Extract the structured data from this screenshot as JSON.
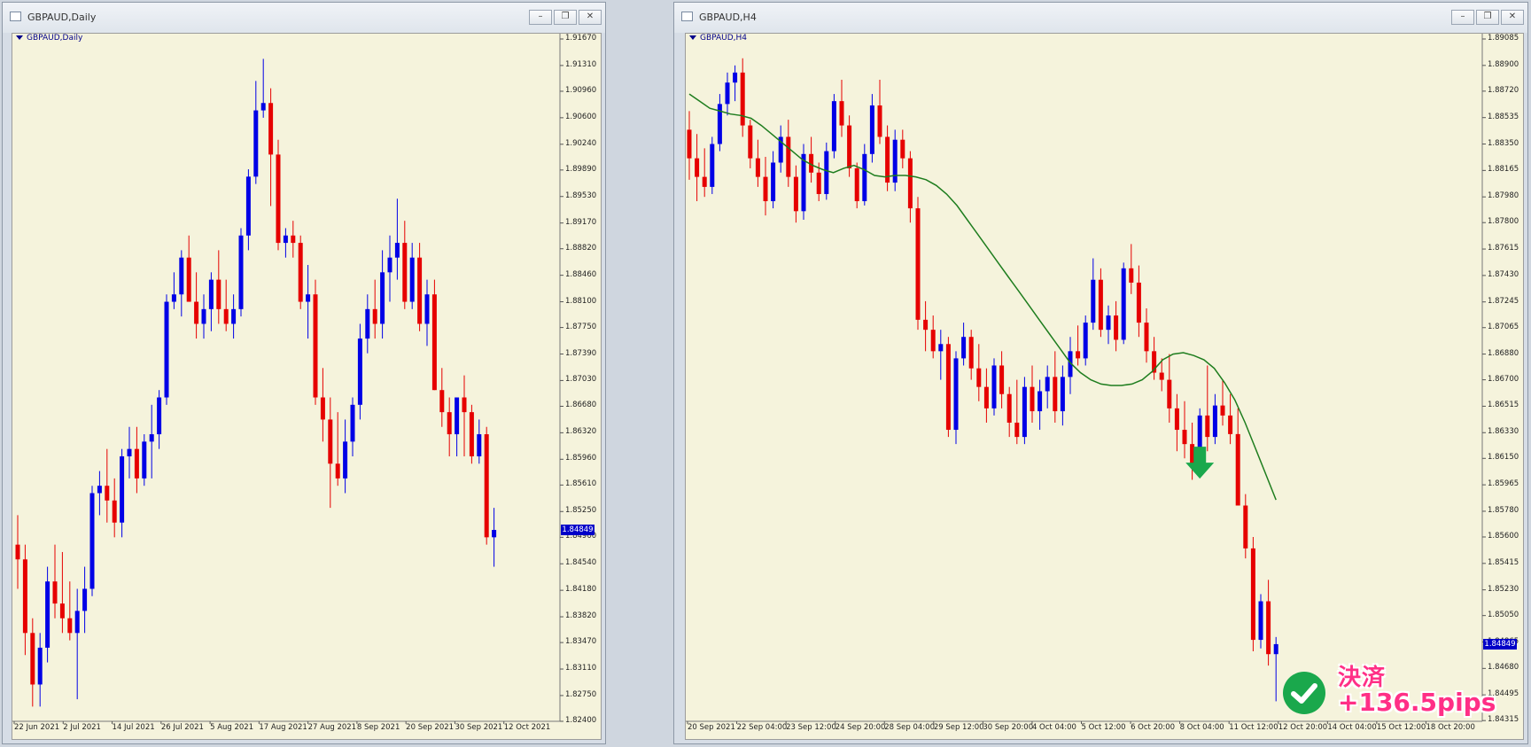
{
  "left_window": {
    "title": "GBPAUD,Daily",
    "chart_label": "GBPAUD,Daily",
    "current_price": "1.84849",
    "controls": [
      "minimize",
      "restore",
      "close"
    ]
  },
  "right_window": {
    "title": "GBPAUD,H4",
    "chart_label": "GBPAUD,H4",
    "current_price": "1.84849",
    "controls": [
      "minimize",
      "restore",
      "close"
    ]
  },
  "overlay": {
    "line1": "決済",
    "line2": "+136.5pips",
    "check_icon": "check-circle-icon",
    "arrow_icon": "down-arrow-icon"
  },
  "colors": {
    "bull": "#0000e6",
    "bear": "#e60000",
    "ma": "#1e7d1e",
    "chart_bg": "#f5f3dc",
    "arrow": "#1aa84c"
  },
  "chart_data": [
    {
      "type": "candlestick",
      "symbol": "GBPAUD",
      "timeframe": "Daily",
      "ylim": [
        1.824,
        1.9167
      ],
      "y_ticks": [
        "1.91670",
        "1.91310",
        "1.90960",
        "1.90600",
        "1.90240",
        "1.89890",
        "1.89530",
        "1.89170",
        "1.88820",
        "1.88460",
        "1.88100",
        "1.87750",
        "1.87390",
        "1.87030",
        "1.86680",
        "1.86320",
        "1.85960",
        "1.85610",
        "1.85250",
        "1.84900",
        "1.84540",
        "1.84180",
        "1.83820",
        "1.83470",
        "1.83110",
        "1.82750",
        "1.82400"
      ],
      "x_ticks": [
        "22 Jun 2021",
        "2 Jul 2021",
        "14 Jul 2021",
        "26 Jul 2021",
        "5 Aug 2021",
        "17 Aug 2021",
        "27 Aug 2021",
        "8 Sep 2021",
        "20 Sep 2021",
        "30 Sep 2021",
        "12 Oct 2021"
      ],
      "ohlc": [
        [
          1.848,
          1.852,
          1.842,
          1.846
        ],
        [
          1.846,
          1.848,
          1.833,
          1.836
        ],
        [
          1.836,
          1.838,
          1.826,
          1.829
        ],
        [
          1.829,
          1.836,
          1.826,
          1.834
        ],
        [
          1.834,
          1.845,
          1.832,
          1.843
        ],
        [
          1.843,
          1.848,
          1.838,
          1.84
        ],
        [
          1.84,
          1.847,
          1.836,
          1.838
        ],
        [
          1.838,
          1.843,
          1.835,
          1.836
        ],
        [
          1.836,
          1.842,
          1.827,
          1.839
        ],
        [
          1.839,
          1.845,
          1.836,
          1.842
        ],
        [
          1.842,
          1.856,
          1.841,
          1.855
        ],
        [
          1.855,
          1.858,
          1.852,
          1.856
        ],
        [
          1.856,
          1.861,
          1.851,
          1.854
        ],
        [
          1.854,
          1.857,
          1.849,
          1.851
        ],
        [
          1.851,
          1.861,
          1.849,
          1.86
        ],
        [
          1.86,
          1.864,
          1.857,
          1.861
        ],
        [
          1.861,
          1.864,
          1.855,
          1.857
        ],
        [
          1.857,
          1.863,
          1.856,
          1.862
        ],
        [
          1.862,
          1.867,
          1.857,
          1.863
        ],
        [
          1.863,
          1.869,
          1.861,
          1.868
        ],
        [
          1.868,
          1.882,
          1.867,
          1.881
        ],
        [
          1.881,
          1.885,
          1.88,
          1.882
        ],
        [
          1.882,
          1.888,
          1.879,
          1.887
        ],
        [
          1.887,
          1.89,
          1.881,
          1.881
        ],
        [
          1.881,
          1.885,
          1.876,
          1.878
        ],
        [
          1.878,
          1.882,
          1.876,
          1.88
        ],
        [
          1.88,
          1.885,
          1.877,
          1.884
        ],
        [
          1.884,
          1.888,
          1.878,
          1.88
        ],
        [
          1.88,
          1.884,
          1.877,
          1.878
        ],
        [
          1.878,
          1.882,
          1.876,
          1.88
        ],
        [
          1.88,
          1.891,
          1.879,
          1.89
        ],
        [
          1.89,
          1.899,
          1.888,
          1.898
        ],
        [
          1.898,
          1.911,
          1.897,
          1.907
        ],
        [
          1.907,
          1.914,
          1.906,
          1.908
        ],
        [
          1.908,
          1.91,
          1.894,
          1.901
        ],
        [
          1.901,
          1.903,
          1.888,
          1.889
        ],
        [
          1.889,
          1.891,
          1.887,
          1.89
        ],
        [
          1.89,
          1.892,
          1.887,
          1.889
        ],
        [
          1.889,
          1.89,
          1.88,
          1.881
        ],
        [
          1.881,
          1.886,
          1.876,
          1.882
        ],
        [
          1.882,
          1.884,
          1.867,
          1.868
        ],
        [
          1.868,
          1.872,
          1.862,
          1.865
        ],
        [
          1.865,
          1.868,
          1.853,
          1.859
        ],
        [
          1.859,
          1.866,
          1.856,
          1.857
        ],
        [
          1.857,
          1.865,
          1.855,
          1.862
        ],
        [
          1.862,
          1.868,
          1.86,
          1.867
        ],
        [
          1.867,
          1.878,
          1.865,
          1.876
        ],
        [
          1.876,
          1.882,
          1.874,
          1.88
        ],
        [
          1.88,
          1.884,
          1.876,
          1.878
        ],
        [
          1.878,
          1.888,
          1.876,
          1.885
        ],
        [
          1.885,
          1.89,
          1.881,
          1.887
        ],
        [
          1.887,
          1.895,
          1.884,
          1.889
        ],
        [
          1.889,
          1.892,
          1.88,
          1.881
        ],
        [
          1.881,
          1.889,
          1.88,
          1.887
        ],
        [
          1.887,
          1.889,
          1.877,
          1.878
        ],
        [
          1.878,
          1.884,
          1.875,
          1.882
        ],
        [
          1.882,
          1.884,
          1.869,
          1.869
        ],
        [
          1.869,
          1.872,
          1.864,
          1.866
        ],
        [
          1.866,
          1.868,
          1.86,
          1.863
        ],
        [
          1.863,
          1.868,
          1.86,
          1.868
        ],
        [
          1.868,
          1.871,
          1.86,
          1.866
        ],
        [
          1.866,
          1.867,
          1.859,
          1.86
        ],
        [
          1.86,
          1.865,
          1.859,
          1.863
        ],
        [
          1.863,
          1.864,
          1.848,
          1.849
        ],
        [
          1.849,
          1.853,
          1.845,
          1.85
        ]
      ]
    },
    {
      "type": "candlestick",
      "symbol": "GBPAUD",
      "timeframe": "H4",
      "ylim": [
        1.8431,
        1.89085
      ],
      "y_ticks": [
        "1.89085",
        "1.88900",
        "1.88720",
        "1.88535",
        "1.88350",
        "1.88165",
        "1.87980",
        "1.87800",
        "1.87615",
        "1.87430",
        "1.87245",
        "1.87065",
        "1.86880",
        "1.86700",
        "1.86515",
        "1.86330",
        "1.86150",
        "1.85965",
        "1.85780",
        "1.85600",
        "1.85415",
        "1.85230",
        "1.85050",
        "1.84865",
        "1.84680",
        "1.84495",
        "1.84315"
      ],
      "x_ticks": [
        "20 Sep 2021",
        "22 Sep 04:00",
        "23 Sep 12:00",
        "24 Sep 20:00",
        "28 Sep 04:00",
        "29 Sep 12:00",
        "30 Sep 20:00",
        "4 Oct 04:00",
        "5 Oct 12:00",
        "6 Oct 20:00",
        "8 Oct 04:00",
        "11 Oct 12:00",
        "12 Oct 20:00",
        "14 Oct 04:00",
        "15 Oct 12:00",
        "18 Oct 20:00"
      ],
      "ohlc": [
        [
          1.8845,
          1.8858,
          1.881,
          1.8825
        ],
        [
          1.8825,
          1.8842,
          1.8795,
          1.8812
        ],
        [
          1.8812,
          1.8832,
          1.8798,
          1.8805
        ],
        [
          1.8805,
          1.884,
          1.88,
          1.8835
        ],
        [
          1.8835,
          1.887,
          1.883,
          1.8863
        ],
        [
          1.8863,
          1.8885,
          1.8855,
          1.8878
        ],
        [
          1.8878,
          1.889,
          1.8865,
          1.8885
        ],
        [
          1.8885,
          1.8895,
          1.884,
          1.8848
        ],
        [
          1.8848,
          1.8852,
          1.8818,
          1.8825
        ],
        [
          1.8825,
          1.8838,
          1.8805,
          1.8812
        ],
        [
          1.8812,
          1.8826,
          1.8785,
          1.8795
        ],
        [
          1.8795,
          1.883,
          1.879,
          1.8822
        ],
        [
          1.8822,
          1.8848,
          1.8815,
          1.884
        ],
        [
          1.884,
          1.8852,
          1.8805,
          1.8812
        ],
        [
          1.8812,
          1.882,
          1.878,
          1.8788
        ],
        [
          1.8788,
          1.8835,
          1.8782,
          1.8828
        ],
        [
          1.8828,
          1.884,
          1.8808,
          1.8815
        ],
        [
          1.8815,
          1.8822,
          1.8795,
          1.88
        ],
        [
          1.88,
          1.8836,
          1.8796,
          1.883
        ],
        [
          1.883,
          1.887,
          1.8825,
          1.8865
        ],
        [
          1.8865,
          1.888,
          1.884,
          1.8848
        ],
        [
          1.8848,
          1.8855,
          1.8812,
          1.8818
        ],
        [
          1.8818,
          1.8822,
          1.879,
          1.8795
        ],
        [
          1.8795,
          1.8835,
          1.8792,
          1.8828
        ],
        [
          1.8828,
          1.887,
          1.8822,
          1.8862
        ],
        [
          1.8862,
          1.888,
          1.8835,
          1.884
        ],
        [
          1.884,
          1.8848,
          1.8802,
          1.8808
        ],
        [
          1.8808,
          1.8845,
          1.8802,
          1.8838
        ],
        [
          1.8838,
          1.8845,
          1.8818,
          1.8825
        ],
        [
          1.8825,
          1.883,
          1.878,
          1.879
        ],
        [
          1.879,
          1.8798,
          1.8705,
          1.8712
        ],
        [
          1.8712,
          1.8725,
          1.869,
          1.8705
        ],
        [
          1.8705,
          1.8715,
          1.8685,
          1.869
        ],
        [
          1.869,
          1.8705,
          1.867,
          1.8695
        ],
        [
          1.8695,
          1.87,
          1.863,
          1.8635
        ],
        [
          1.8635,
          1.869,
          1.8625,
          1.8685
        ],
        [
          1.8685,
          1.871,
          1.868,
          1.87
        ],
        [
          1.87,
          1.8705,
          1.867,
          1.8678
        ],
        [
          1.8678,
          1.8695,
          1.8655,
          1.8665
        ],
        [
          1.8665,
          1.8678,
          1.864,
          1.865
        ],
        [
          1.865,
          1.8685,
          1.8645,
          1.868
        ],
        [
          1.868,
          1.869,
          1.865,
          1.866
        ],
        [
          1.866,
          1.8665,
          1.863,
          1.864
        ],
        [
          1.864,
          1.867,
          1.8625,
          1.863
        ],
        [
          1.863,
          1.8672,
          1.8625,
          1.8665
        ],
        [
          1.8665,
          1.868,
          1.864,
          1.8648
        ],
        [
          1.8648,
          1.867,
          1.8635,
          1.8662
        ],
        [
          1.8662,
          1.868,
          1.865,
          1.8672
        ],
        [
          1.8672,
          1.869,
          1.864,
          1.8648
        ],
        [
          1.8648,
          1.868,
          1.8638,
          1.8672
        ],
        [
          1.8672,
          1.87,
          1.866,
          1.869
        ],
        [
          1.869,
          1.8708,
          1.868,
          1.8685
        ],
        [
          1.8685,
          1.8715,
          1.868,
          1.871
        ],
        [
          1.871,
          1.8755,
          1.8705,
          1.874
        ],
        [
          1.874,
          1.8748,
          1.87,
          1.8705
        ],
        [
          1.8705,
          1.8722,
          1.8695,
          1.8715
        ],
        [
          1.8715,
          1.8725,
          1.869,
          1.8698
        ],
        [
          1.8698,
          1.8752,
          1.8695,
          1.8748
        ],
        [
          1.8748,
          1.8765,
          1.873,
          1.8738
        ],
        [
          1.8738,
          1.875,
          1.87,
          1.871
        ],
        [
          1.871,
          1.872,
          1.8682,
          1.869
        ],
        [
          1.869,
          1.87,
          1.867,
          1.8675
        ],
        [
          1.8675,
          1.8685,
          1.8662,
          1.867
        ],
        [
          1.867,
          1.8688,
          1.864,
          1.865
        ],
        [
          1.865,
          1.866,
          1.862,
          1.8635
        ],
        [
          1.8635,
          1.8655,
          1.8615,
          1.8625
        ],
        [
          1.8625,
          1.864,
          1.86,
          1.861
        ],
        [
          1.861,
          1.865,
          1.8605,
          1.8645
        ],
        [
          1.8645,
          1.868,
          1.862,
          1.863
        ],
        [
          1.863,
          1.866,
          1.8625,
          1.8652
        ],
        [
          1.8652,
          1.867,
          1.8638,
          1.8645
        ],
        [
          1.8645,
          1.866,
          1.8625,
          1.8632
        ],
        [
          1.8632,
          1.865,
          1.86,
          1.8582
        ],
        [
          1.8582,
          1.859,
          1.8545,
          1.8552
        ],
        [
          1.8552,
          1.856,
          1.848,
          1.8488
        ],
        [
          1.8488,
          1.852,
          1.8482,
          1.8515
        ],
        [
          1.8515,
          1.853,
          1.847,
          1.8478
        ],
        [
          1.8478,
          1.849,
          1.8445,
          1.8485
        ]
      ],
      "ma": [
        1.887,
        1.8865,
        1.886,
        1.8858,
        1.8856,
        1.8855,
        1.8853,
        1.8848,
        1.8842,
        1.8836,
        1.883,
        1.8824,
        1.882,
        1.8817,
        1.8815,
        1.8818,
        1.882,
        1.8817,
        1.8813,
        1.8812,
        1.8813,
        1.8813,
        1.8812,
        1.881,
        1.8806,
        1.88,
        1.8792,
        1.8782,
        1.8772,
        1.8762,
        1.8752,
        1.8742,
        1.8732,
        1.8722,
        1.8712,
        1.8702,
        1.8692,
        1.8682,
        1.8675,
        1.867,
        1.8667,
        1.8666,
        1.8666,
        1.8667,
        1.867,
        1.8676,
        1.8684,
        1.8688,
        1.8689,
        1.8687,
        1.8684,
        1.8678,
        1.8668,
        1.8656,
        1.864,
        1.8622,
        1.8604,
        1.8586
      ]
    }
  ]
}
